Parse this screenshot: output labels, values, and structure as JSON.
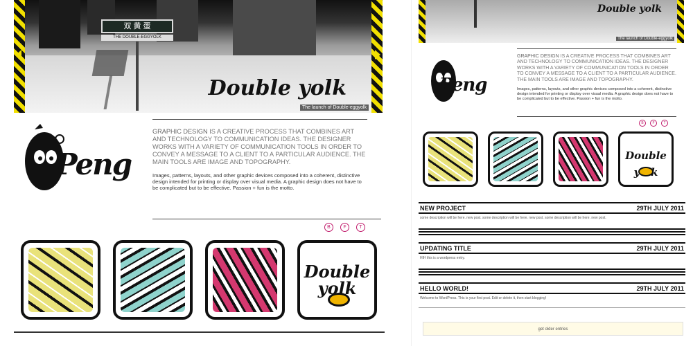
{
  "hero": {
    "caption": "The launch of Double-eggyolk",
    "sign_text": "双 黄 蛋",
    "sign_sub": "THE DOUBLE-EGGYOLK",
    "logo_text": "Double yolk"
  },
  "brand": {
    "logo_text": "Peng"
  },
  "about": {
    "lead_highlight": "GRAPHIC DESIGN",
    "lead_rest": " IS A CREATIVE PROCESS THAT COMBINES ART AND TECHNOLOGY TO COMMUNICATION IDEAS. THE DESIGNER WORKS WITH A VARIETY OF COMMUNICATION TOOLS IN ORDER TO CONVEY A MESSAGE TO A CLIENT TO A PARTICULAR AUDIENCE. THE MAIN TOOLS ARE IMAGE AND TOPOGRAPHY.",
    "body": "Images, patterns, layouts, and other graphic devices composed into a coherent, distinctive design intended for printing or display over visual media. A graphic design does not have to be complicated but to be effective. Passion + fun is the motto."
  },
  "social": [
    "B",
    "F",
    "T"
  ],
  "tiles": [
    {
      "name": "yellow-pattern",
      "color": "#e9e27a",
      "accent": "#111"
    },
    {
      "name": "cyan-pattern",
      "color": "#8fd3cc",
      "accent": "#111"
    },
    {
      "name": "pink-pattern",
      "color": "#d4386f",
      "accent": "#111"
    },
    {
      "name": "double-yolk-logo",
      "color": "#ffffff",
      "accent": "#f0b400",
      "text": "Double yolk"
    }
  ],
  "posts": [
    {
      "title": "NEW PROJECT",
      "date": "29TH JULY 2011",
      "body": "some description will be here. new post. some description will be here. new post. some description will be here. new post."
    },
    {
      "title": "UPDATING TITLE",
      "date": "29TH JULY 2011",
      "body": "HIH this is a wordpress entry."
    },
    {
      "title": "HELLO WORLD!",
      "date": "29TH JULY 2011",
      "body": "Welcome to WordPress. This is your first post. Edit or delete it, then start blogging!"
    }
  ],
  "older_entries": "get older entries",
  "colors": {
    "hazard_yellow": "#f2e000",
    "social_accent": "#c0196a"
  }
}
